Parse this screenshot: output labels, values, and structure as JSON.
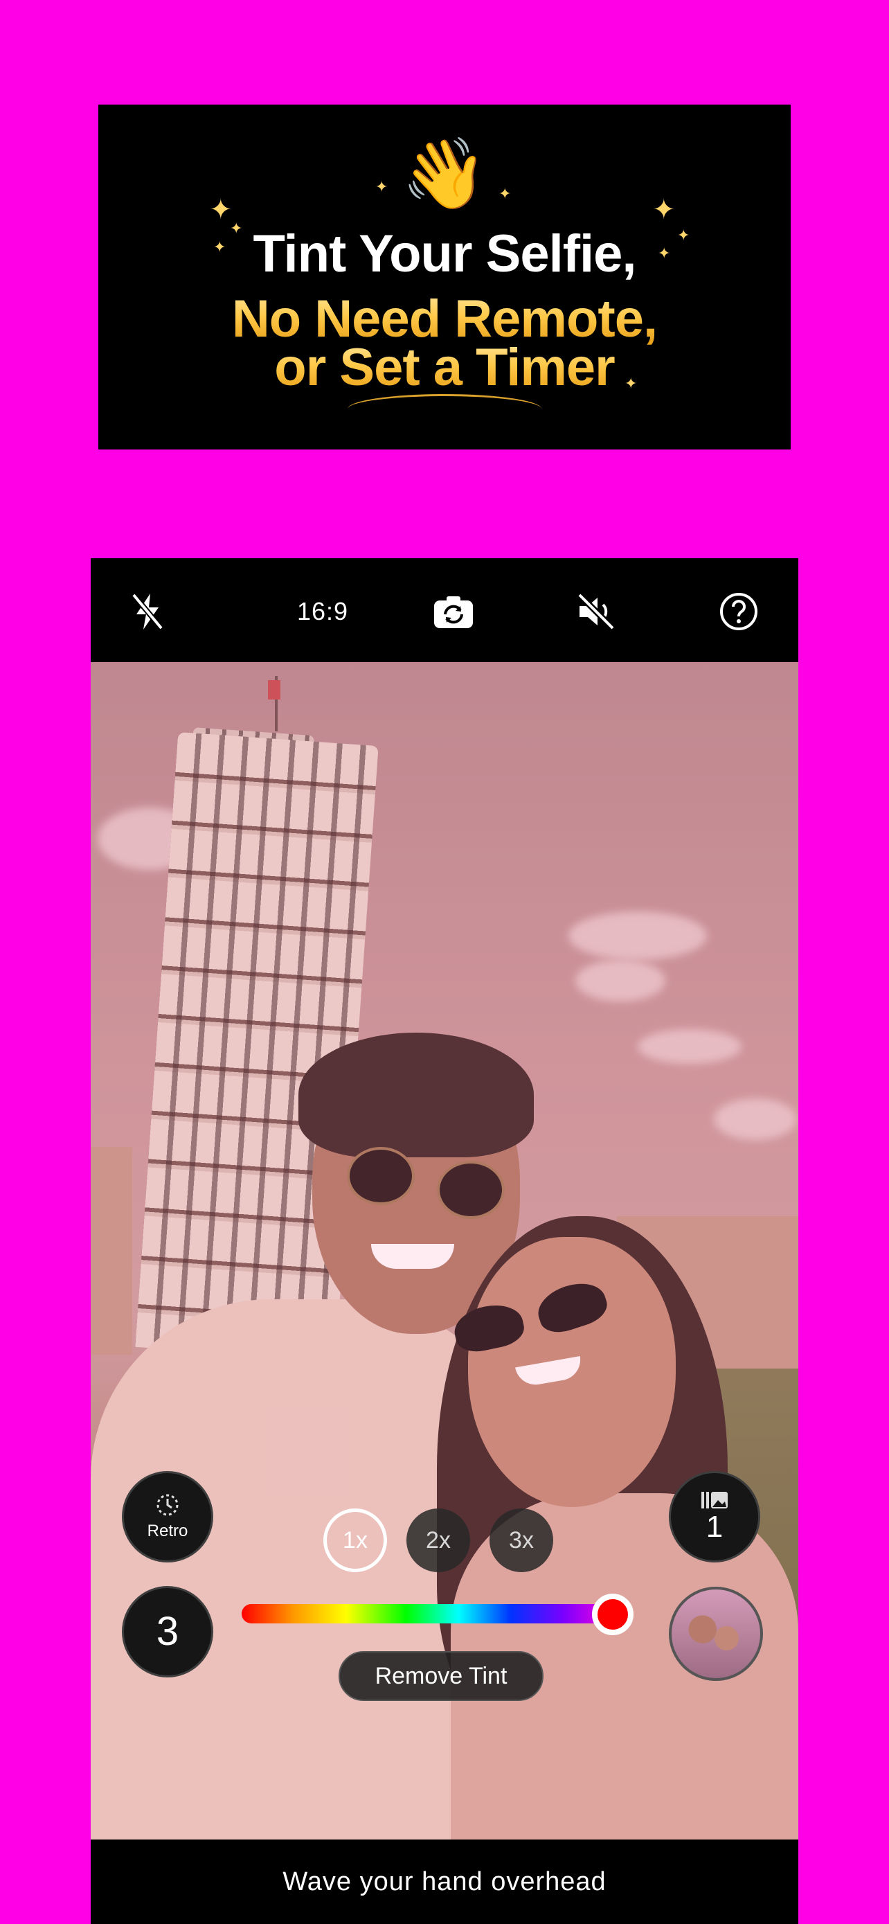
{
  "banner": {
    "emoji": "👋",
    "line1": "Tint Your Selfie,",
    "line2": "No Need Remote,",
    "line3": "or Set a Timer"
  },
  "topbar": {
    "flash_icon": "flash-off-icon",
    "aspect_ratio": "16:9",
    "camera_switch_icon": "camera-switch-icon",
    "sound_icon": "sound-muted-icon",
    "help_icon": "help-icon"
  },
  "controls": {
    "retro_label": "Retro",
    "retro_icon": "timer-dotted-icon",
    "timer_value": "3",
    "zoom_options": [
      "1x",
      "2x",
      "3x"
    ],
    "zoom_selected": "1x",
    "photo_count_icon": "gallery-stack-icon",
    "photo_count": "1",
    "tint_hue_color": "#ff0000",
    "tint_slider_position": 1.0,
    "remove_tint_label": "Remove Tint",
    "last_photo_icon": "last-photo-thumbnail"
  },
  "hint": {
    "text": "Wave your hand overhead"
  },
  "colors": {
    "background": "#ff00e6",
    "bar": "#000000"
  }
}
